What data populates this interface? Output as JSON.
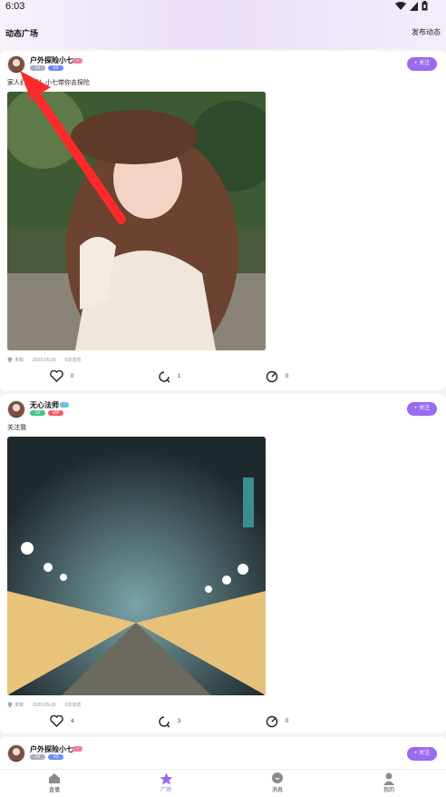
{
  "status_bar": {
    "time": "6:03"
  },
  "header": {
    "title": "动态广场",
    "publish_label": "发布动态"
  },
  "posts": [
    {
      "username": "户外探险小七",
      "badges": [
        "♀",
        "LV",
        "V3"
      ],
      "follow_label": "+ 关注",
      "text": "家人们，我！小七带你去探险",
      "location": "未知",
      "date": "2023-05-29",
      "views": "0次浏览",
      "likes": "0",
      "shares": "1",
      "comments": "0"
    },
    {
      "username": "无心法师",
      "badges": [
        "♂",
        "LV",
        "VIP"
      ],
      "follow_label": "+ 关注",
      "text": "关注我",
      "location": "未知",
      "date": "2023-05-29",
      "views": "0次浏览",
      "likes": "4",
      "shares": "3",
      "comments": "0"
    },
    {
      "username": "户外探险小七",
      "badges": [
        "♀",
        "LV",
        "V3"
      ],
      "follow_label": "+ 关注"
    }
  ],
  "tabbar": {
    "items": [
      {
        "label": "直播",
        "icon": "home-icon"
      },
      {
        "label": "广场",
        "icon": "star-icon"
      },
      {
        "label": "消息",
        "icon": "message-icon"
      },
      {
        "label": "我的",
        "icon": "user-icon"
      }
    ]
  },
  "colors": {
    "accent": "#9a6af0",
    "annotation_arrow": "#ff2a2a"
  }
}
